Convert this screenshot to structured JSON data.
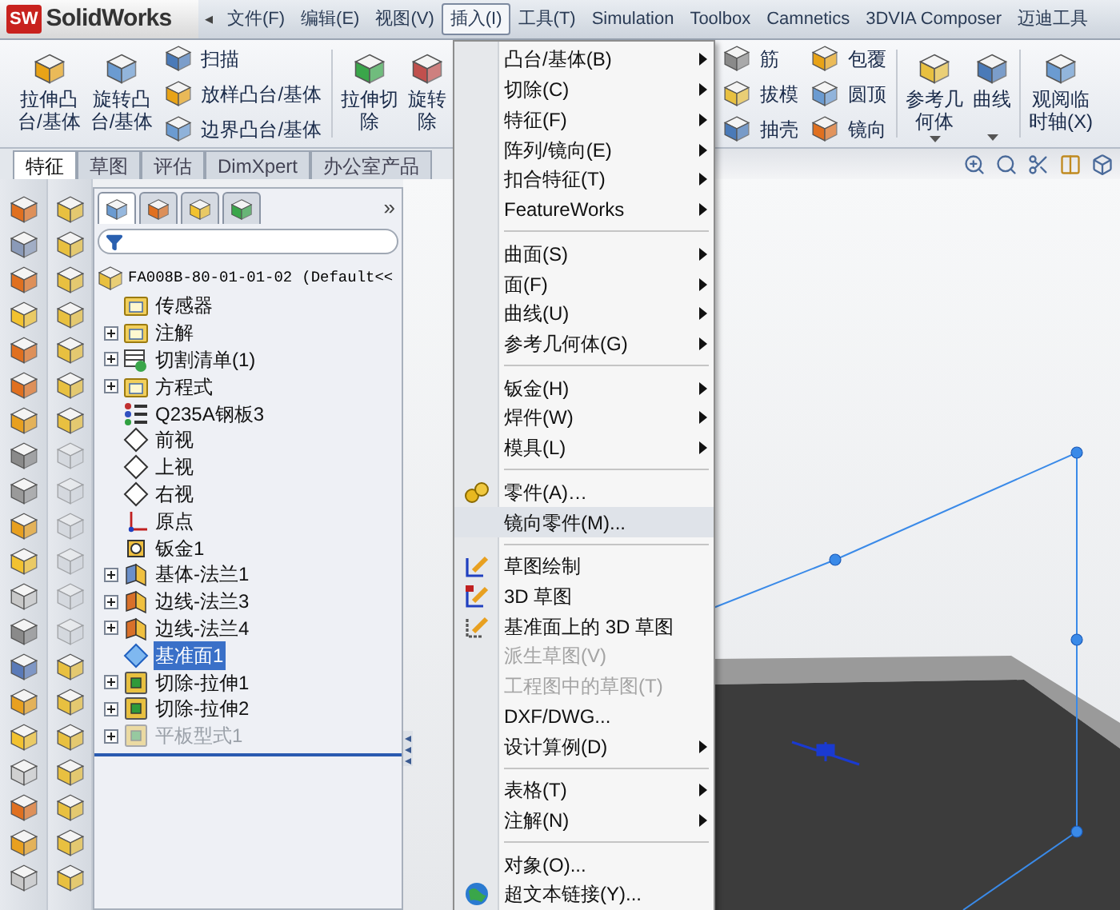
{
  "app": {
    "logo_mark": "SW",
    "logo": "SolidWorks",
    "collapse_glyph": "◂"
  },
  "menubar": [
    {
      "label": "文件(F)",
      "selected": false
    },
    {
      "label": "编辑(E)",
      "selected": false
    },
    {
      "label": "视图(V)",
      "selected": false
    },
    {
      "label": "插入(I)",
      "selected": true
    },
    {
      "label": "工具(T)",
      "selected": false
    },
    {
      "label": "Simulation",
      "selected": false
    },
    {
      "label": "Toolbox",
      "selected": false
    },
    {
      "label": "Camnetics",
      "selected": false
    },
    {
      "label": "3DVIA Composer",
      "selected": false
    },
    {
      "label": "迈迪工具",
      "selected": false
    }
  ],
  "ribbon": {
    "left": [
      {
        "kind": "large",
        "lines": [
          "拉伸凸",
          "台/基体"
        ],
        "dropdown": false
      },
      {
        "kind": "large",
        "lines": [
          "旋转凸",
          "台/基体"
        ],
        "dropdown": false
      },
      {
        "kind": "stack",
        "items": [
          "扫描",
          "放样凸台/基体",
          "边界凸台/基体"
        ]
      },
      {
        "kind": "divider"
      },
      {
        "kind": "large",
        "lines": [
          "拉伸切",
          "除"
        ],
        "dropdown": false
      },
      {
        "kind": "large",
        "lines": [
          "旋转",
          "除"
        ],
        "dropdown": false
      }
    ],
    "right": [
      {
        "kind": "stack",
        "items": [
          "筋",
          "拔模",
          "抽壳"
        ]
      },
      {
        "kind": "stack",
        "items": [
          "包覆",
          "圆顶",
          "镜向"
        ]
      },
      {
        "kind": "divider"
      },
      {
        "kind": "large",
        "lines": [
          "参考几",
          "何体"
        ],
        "dropdown": true
      },
      {
        "kind": "large",
        "lines": [
          "曲线"
        ],
        "dropdown": true
      },
      {
        "kind": "divider"
      },
      {
        "kind": "large",
        "lines": [
          "观阅临",
          "时轴(X)"
        ],
        "dropdown": false
      }
    ]
  },
  "command_tabs": [
    {
      "label": "特征",
      "selected": true
    },
    {
      "label": "草图",
      "selected": false
    },
    {
      "label": "评估",
      "selected": false
    },
    {
      "label": "DimXpert",
      "selected": false
    },
    {
      "label": "办公室产品",
      "selected": false
    }
  ],
  "feature_tree": {
    "panel_tabs": [
      {
        "selected": true
      },
      {
        "selected": false
      },
      {
        "selected": false
      },
      {
        "selected": false
      }
    ],
    "overflow": "»",
    "root": {
      "label": "FA008B-80-01-01-02",
      "config": "(Default<<",
      "children": [
        {
          "kind": "sensor",
          "label": "传感器",
          "collapsed": false,
          "selected": false,
          "disabled": false
        },
        {
          "kind": "annotation",
          "label": "注解",
          "collapsed": true,
          "selected": false,
          "disabled": false
        },
        {
          "kind": "cutlist",
          "label": "切割清单(1)",
          "collapsed": true,
          "selected": false,
          "disabled": false
        },
        {
          "kind": "equation",
          "label": "方程式",
          "collapsed": true,
          "selected": false,
          "disabled": false
        },
        {
          "kind": "material",
          "label": "Q235A钢板3",
          "collapsed": false,
          "selected": false,
          "disabled": false
        },
        {
          "kind": "plane",
          "label": "前视",
          "collapsed": false,
          "selected": false,
          "disabled": false
        },
        {
          "kind": "plane",
          "label": "上视",
          "collapsed": false,
          "selected": false,
          "disabled": false
        },
        {
          "kind": "plane",
          "label": "右视",
          "collapsed": false,
          "selected": false,
          "disabled": false
        },
        {
          "kind": "origin",
          "label": "原点",
          "collapsed": false,
          "selected": false,
          "disabled": false
        },
        {
          "kind": "sheetmetal",
          "label": "钣金1",
          "collapsed": false,
          "selected": false,
          "disabled": false
        },
        {
          "kind": "flange",
          "label": "基体-法兰1",
          "collapsed": true,
          "selected": false,
          "disabled": false
        },
        {
          "kind": "edgeflange",
          "label": "边线-法兰3",
          "collapsed": true,
          "selected": false,
          "disabled": false
        },
        {
          "kind": "edgeflange",
          "label": "边线-法兰4",
          "collapsed": true,
          "selected": false,
          "disabled": false
        },
        {
          "kind": "refplane",
          "label": "基准面1",
          "collapsed": false,
          "selected": true,
          "disabled": false
        },
        {
          "kind": "cut",
          "label": "切除-拉伸1",
          "collapsed": true,
          "selected": false,
          "disabled": false
        },
        {
          "kind": "cut",
          "label": "切除-拉伸2",
          "collapsed": true,
          "selected": false,
          "disabled": false
        },
        {
          "kind": "flatpattern",
          "label": "平板型式1",
          "collapsed": true,
          "selected": false,
          "disabled": true
        }
      ]
    }
  },
  "menu": [
    {
      "kind": "item",
      "label": "凸台/基体(B)",
      "submenu": true,
      "disabled": false,
      "selected": false
    },
    {
      "kind": "item",
      "label": "切除(C)",
      "submenu": true,
      "disabled": false,
      "selected": false
    },
    {
      "kind": "item",
      "label": "特征(F)",
      "submenu": true,
      "disabled": false,
      "selected": false
    },
    {
      "kind": "item",
      "label": "阵列/镜向(E)",
      "submenu": true,
      "disabled": false,
      "selected": false
    },
    {
      "kind": "item",
      "label": "扣合特征(T)",
      "submenu": true,
      "disabled": false,
      "selected": false
    },
    {
      "kind": "item",
      "label": "FeatureWorks",
      "submenu": true,
      "disabled": false,
      "selected": false
    },
    {
      "kind": "separator"
    },
    {
      "kind": "item",
      "label": "曲面(S)",
      "submenu": true,
      "disabled": false,
      "selected": false
    },
    {
      "kind": "item",
      "label": "面(F)",
      "submenu": true,
      "disabled": false,
      "selected": false
    },
    {
      "kind": "item",
      "label": "曲线(U)",
      "submenu": true,
      "disabled": false,
      "selected": false
    },
    {
      "kind": "item",
      "label": "参考几何体(G)",
      "submenu": true,
      "disabled": false,
      "selected": false
    },
    {
      "kind": "separator"
    },
    {
      "kind": "item",
      "label": "钣金(H)",
      "submenu": true,
      "disabled": false,
      "selected": false
    },
    {
      "kind": "item",
      "label": "焊件(W)",
      "submenu": true,
      "disabled": false,
      "selected": false
    },
    {
      "kind": "item",
      "label": "模具(L)",
      "submenu": true,
      "disabled": false,
      "selected": false
    },
    {
      "kind": "separator"
    },
    {
      "kind": "item",
      "label": "零件(A)…",
      "submenu": false,
      "disabled": false,
      "selected": false
    },
    {
      "kind": "item",
      "label": "镜向零件(M)...",
      "submenu": false,
      "disabled": false,
      "selected": true
    },
    {
      "kind": "separator"
    },
    {
      "kind": "item",
      "label": "草图绘制",
      "submenu": false,
      "disabled": false,
      "selected": false
    },
    {
      "kind": "item",
      "label": "3D 草图",
      "submenu": false,
      "disabled": false,
      "selected": false
    },
    {
      "kind": "item",
      "label": "基准面上的 3D 草图",
      "submenu": false,
      "disabled": false,
      "selected": false
    },
    {
      "kind": "item",
      "label": "派生草图(V)",
      "submenu": false,
      "disabled": true,
      "selected": false
    },
    {
      "kind": "item",
      "label": "工程图中的草图(T)",
      "submenu": false,
      "disabled": true,
      "selected": false
    },
    {
      "kind": "item",
      "label": "DXF/DWG...",
      "submenu": false,
      "disabled": false,
      "selected": false
    },
    {
      "kind": "item",
      "label": "设计算例(D)",
      "submenu": true,
      "disabled": false,
      "selected": false
    },
    {
      "kind": "separator"
    },
    {
      "kind": "item",
      "label": "表格(T)",
      "submenu": true,
      "disabled": false,
      "selected": false
    },
    {
      "kind": "item",
      "label": "注解(N)",
      "submenu": true,
      "disabled": false,
      "selected": false
    },
    {
      "kind": "separator"
    },
    {
      "kind": "item",
      "label": "对象(O)...",
      "submenu": false,
      "disabled": false,
      "selected": false
    },
    {
      "kind": "item",
      "label": "超文本链接(Y)...",
      "submenu": false,
      "disabled": false,
      "selected": false
    }
  ]
}
